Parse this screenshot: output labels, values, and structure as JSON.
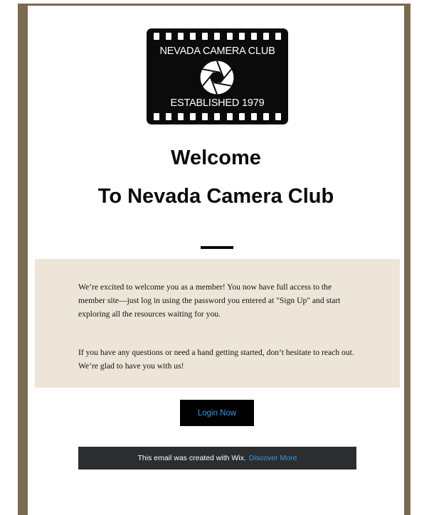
{
  "logo": {
    "title": "NEVADA CAMERA CLUB",
    "established": "ESTABLISHED 1979",
    "icon": "camera-aperture-icon"
  },
  "heading": {
    "line1": "Welcome",
    "line2": "To Nevada Camera Club"
  },
  "message": {
    "paragraph1": "We’re excited to welcome you as a member! You now have full access to the member site—just log in using the password you entered at \"Sign Up\" and start exploring all the resources waiting for you.",
    "paragraph2": "If you have any questions or need a hand getting started, don’t hesitate to reach out. We’re glad to have you with us!"
  },
  "button": {
    "label": "Login Now"
  },
  "footer": {
    "text": "This email was created with Wix.",
    "link": "Discover More"
  },
  "colors": {
    "frame": "#7a6a50",
    "message_background": "#ede5d8",
    "button_background": "#000000",
    "link": "#3899ec",
    "footer_background": "#2c2d30"
  }
}
